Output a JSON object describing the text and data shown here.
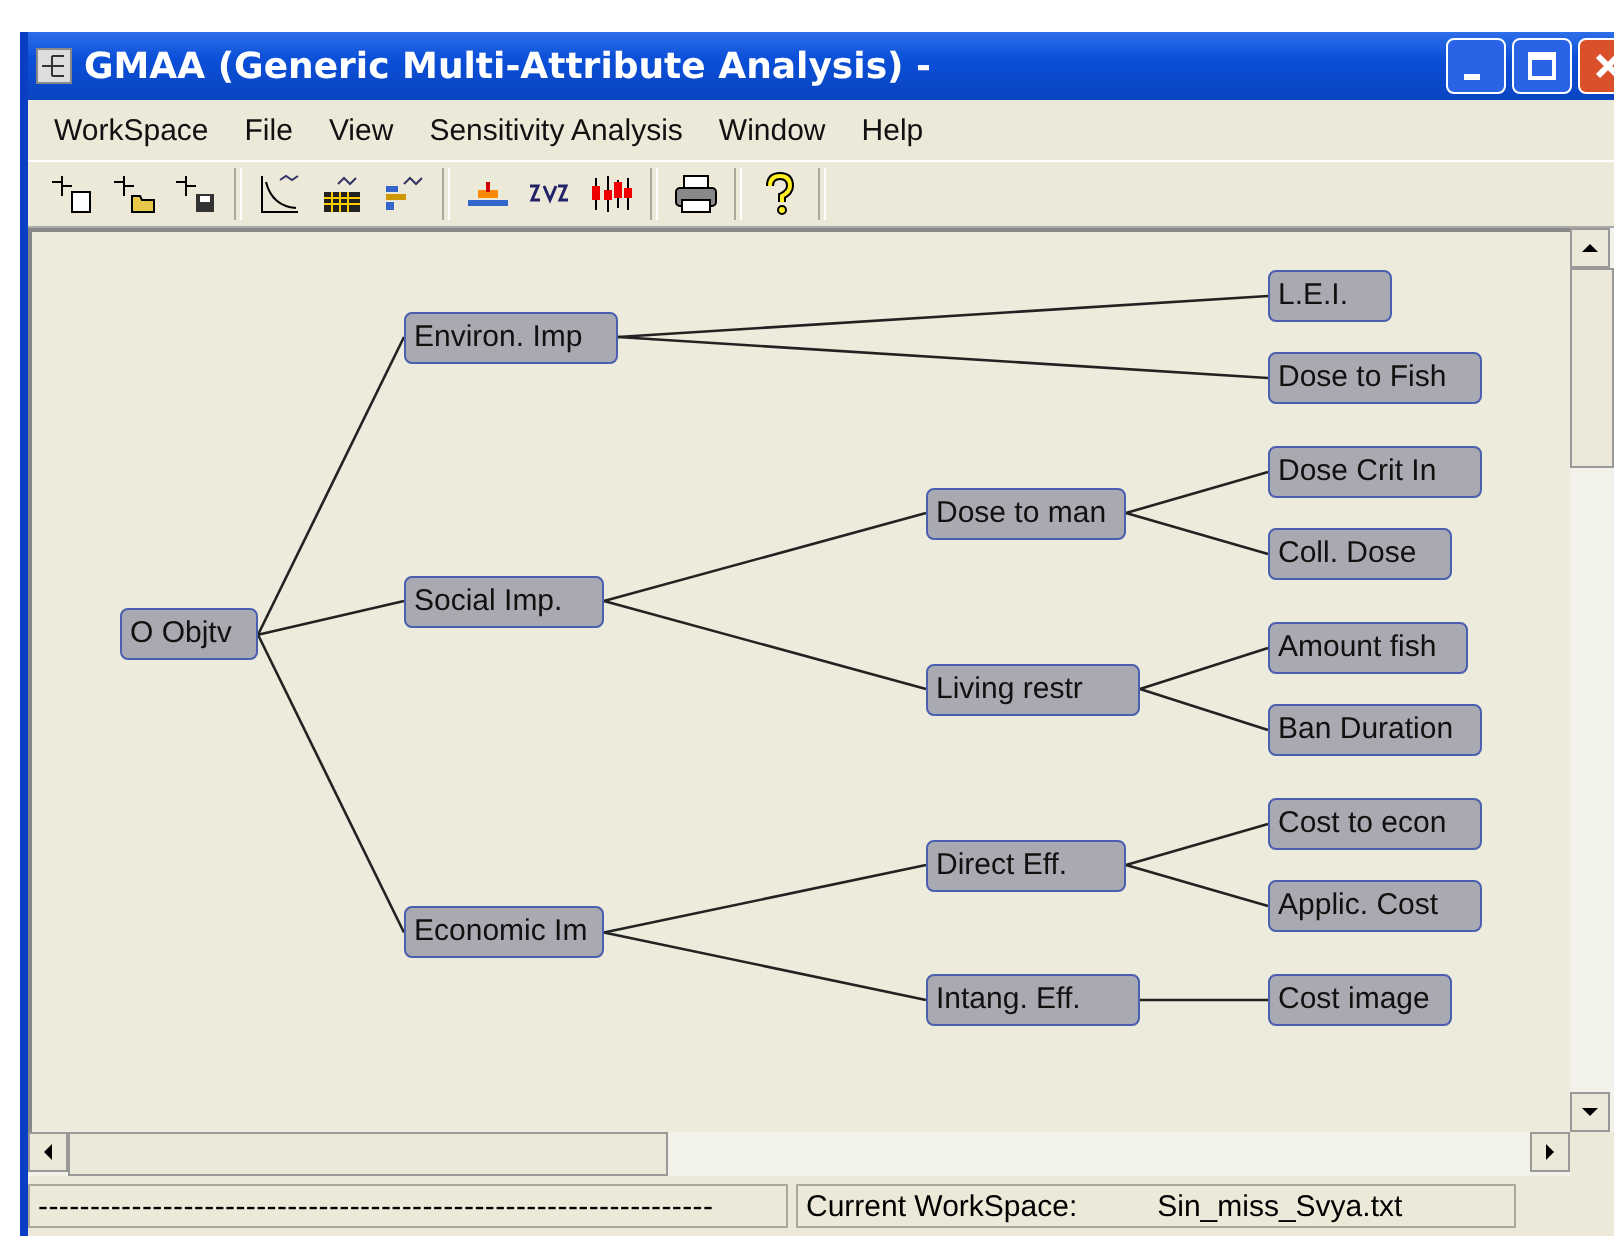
{
  "window": {
    "title": "GMAA (Generic Multi-Attribute Analysis) -"
  },
  "menu": [
    "WorkSpace",
    "File",
    "View",
    "Sensitivity Analysis",
    "Window",
    "Help"
  ],
  "tree": {
    "label": "O Objtv",
    "children": [
      {
        "label": "Environ. Imp",
        "children": [
          {
            "label": "L.E.I."
          },
          {
            "label": "Dose to Fish"
          }
        ]
      },
      {
        "label": "Social Imp.",
        "children": [
          {
            "label": "Dose to man",
            "children": [
              {
                "label": "Dose Crit In"
              },
              {
                "label": "Coll. Dose"
              }
            ]
          },
          {
            "label": "Living restr",
            "children": [
              {
                "label": "Amount fish"
              },
              {
                "label": "Ban Duration"
              }
            ]
          }
        ]
      },
      {
        "label": "Economic Im",
        "children": [
          {
            "label": "Direct Eff.",
            "children": [
              {
                "label": "Cost to econ"
              },
              {
                "label": "Applic. Cost"
              }
            ]
          },
          {
            "label": "Intang. Eff.",
            "children": [
              {
                "label": "Cost image"
              }
            ]
          }
        ]
      }
    ]
  },
  "status_bar": {
    "left": "-----------------------------------------------------------------",
    "label": "Current WorkSpace:",
    "file": "Sin_miss_Svya.txt"
  }
}
